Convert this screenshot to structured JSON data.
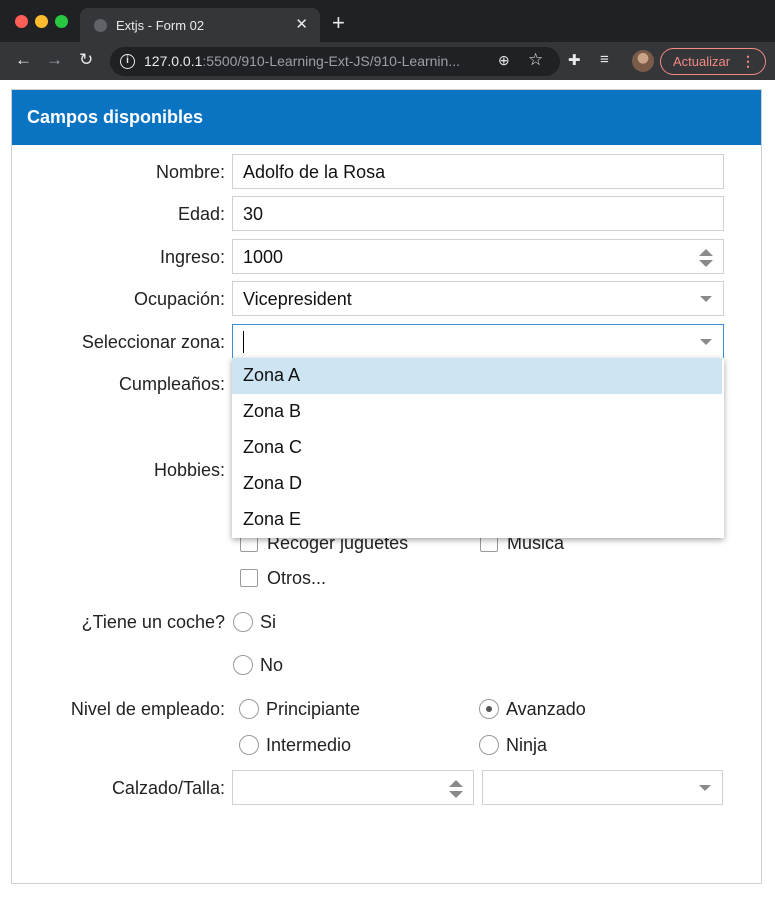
{
  "browser": {
    "tab_title": "Extjs - Form 02",
    "url_host": "127.0.0.1",
    "url_path": ":5500/910-Learning-Ext-JS/910-Learnin...",
    "update_label": "Actualizar"
  },
  "panel": {
    "title": "Campos disponibles"
  },
  "form": {
    "nombre": {
      "label": "Nombre:",
      "value": "Adolfo de la Rosa"
    },
    "edad": {
      "label": "Edad:",
      "value": "30"
    },
    "ingreso": {
      "label": "Ingreso:",
      "value": "1000"
    },
    "ocupacion": {
      "label": "Ocupación:",
      "value": "Vicepresident"
    },
    "zona": {
      "label": "Seleccionar zona:",
      "value": ""
    },
    "cumpleanos": {
      "label": "Cumpleaños:"
    },
    "hobbies": {
      "label": "Hobbies:",
      "options": [
        {
          "label": "Recoger juguetes",
          "checked": false
        },
        {
          "label": "Musica",
          "checked": false
        },
        {
          "label": "Otros...",
          "checked": false
        }
      ]
    },
    "coche": {
      "label": "¿Tiene un coche?",
      "options": [
        {
          "label": "Si",
          "checked": false
        },
        {
          "label": "No",
          "checked": false
        }
      ]
    },
    "nivel": {
      "label": "Nivel de empleado:",
      "options": [
        {
          "label": "Principiante",
          "checked": false
        },
        {
          "label": "Avanzado",
          "checked": true
        },
        {
          "label": "Intermedio",
          "checked": false
        },
        {
          "label": "Ninja",
          "checked": false
        }
      ]
    },
    "calzado": {
      "label": "Calzado/Talla:",
      "size_value": "",
      "type_value": ""
    }
  },
  "zona_dropdown": {
    "options": [
      "Zona A",
      "Zona B",
      "Zona C",
      "Zona D",
      "Zona E"
    ],
    "highlighted": "Zona A"
  }
}
